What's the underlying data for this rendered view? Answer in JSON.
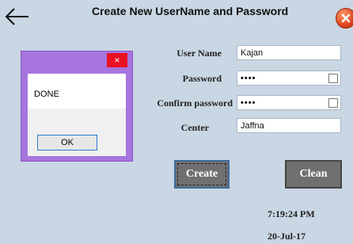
{
  "window": {
    "title": "Create New UserName and Password"
  },
  "form": {
    "username_label": "User Name",
    "username_value": "Kajan",
    "password_label": "Password",
    "password_value": "••••",
    "confirm_label": "Confirm password",
    "confirm_value": "••••",
    "center_label": "Center",
    "center_value": "Jaffna"
  },
  "buttons": {
    "create_label": "Create",
    "clean_label": "Clean"
  },
  "clock": {
    "time": "7:19:24 PM",
    "date": "20-Jul-17"
  },
  "dialog": {
    "close_glyph": "×",
    "message": "DONE",
    "ok_label": "OK"
  },
  "colors": {
    "background": "#c9d6e3",
    "dialog_frame": "#a775de",
    "button_bg": "#707070",
    "close_red": "#e81123"
  },
  "icons": {
    "back": "back-arrow-icon",
    "window_close": "close-icon"
  }
}
